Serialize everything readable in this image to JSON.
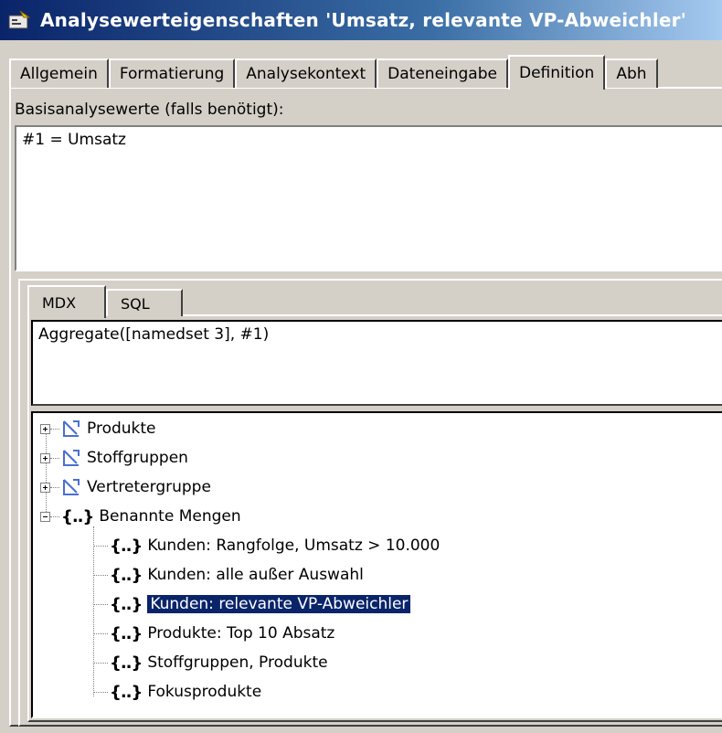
{
  "window": {
    "title": "Analysewerteigenschaften 'Umsatz, relevante VP-Abweichler'"
  },
  "main_tabs": [
    {
      "label": "Allgemein",
      "active": false
    },
    {
      "label": "Formatierung",
      "active": false
    },
    {
      "label": "Analysekontext",
      "active": false
    },
    {
      "label": "Dateneingabe",
      "active": false
    },
    {
      "label": "Definition",
      "active": true
    },
    {
      "label": "Abh",
      "active": false
    }
  ],
  "definition": {
    "basis_label": "Basisanalysewerte (falls benötigt):",
    "basis_value": "#1 = Umsatz",
    "sub_tabs": [
      {
        "label": "MDX",
        "active": true
      },
      {
        "label": "SQL",
        "active": false
      }
    ],
    "mdx_value": "Aggregate([namedset 3], #1)"
  },
  "tree": {
    "dimensions": [
      {
        "label": "Produkte",
        "icon": "dimension-icon"
      },
      {
        "label": "Stoffgruppen",
        "icon": "dimension-icon"
      },
      {
        "label": "Vertretergruppe",
        "icon": "dimension-icon"
      }
    ],
    "named_sets_node": {
      "label": "Benannte Mengen",
      "icon": "named-set-icon"
    },
    "named_sets": [
      {
        "label": "Kunden: Rangfolge, Umsatz > 10.000",
        "selected": false
      },
      {
        "label": "Kunden: alle außer Auswahl",
        "selected": false
      },
      {
        "label": "Kunden: relevante VP-Abweichler",
        "selected": true
      },
      {
        "label": "Produkte: Top 10 Absatz",
        "selected": false
      },
      {
        "label": "Stoffgruppen, Produkte",
        "selected": false
      },
      {
        "label": "Fokusprodukte",
        "selected": false
      }
    ],
    "set_icon_glyph": "{..}"
  },
  "colors": {
    "titlebar_start": "#0a246a",
    "selection": "#0a246a",
    "dimension_icon": "#4a6fd0",
    "face": "#d4d0c8"
  }
}
